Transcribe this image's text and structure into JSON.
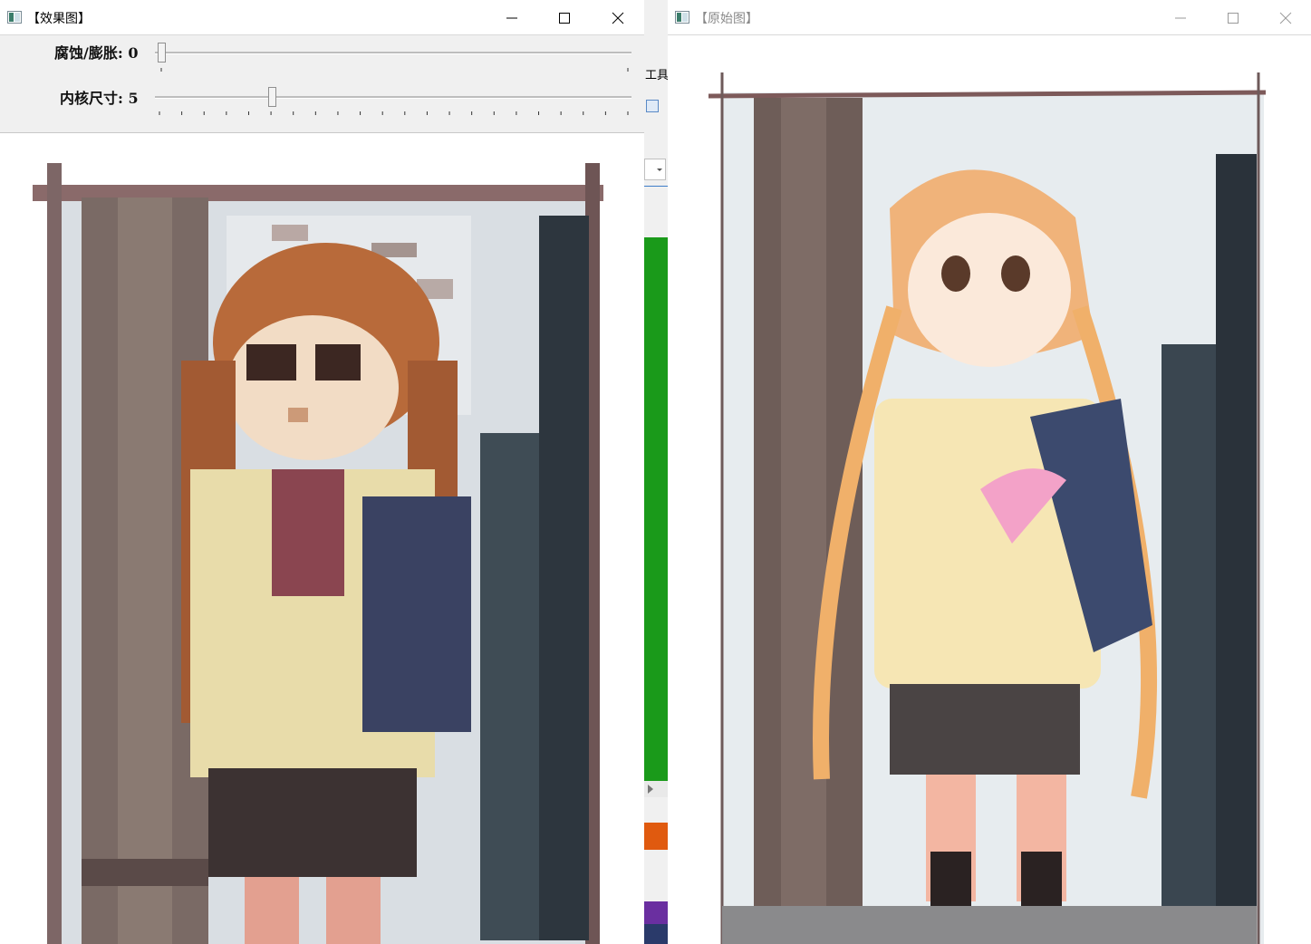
{
  "effect_window": {
    "title": "【效果图】",
    "controls": [
      "minimize",
      "maximize",
      "close"
    ],
    "trackbars": [
      {
        "label": "腐蚀/膨胀: 0",
        "value": 0,
        "max": 1
      },
      {
        "label": "内核尺寸: 5",
        "value": 5,
        "max": 21
      }
    ]
  },
  "original_window": {
    "title": "【原始图】",
    "controls": [
      "minimize",
      "maximize",
      "close"
    ]
  },
  "background_window": {
    "text_fragment": "工具(",
    "accent_colors": [
      "#1a9a1a",
      "#e05a0f",
      "#6a2fa0",
      "#2a3a6a"
    ]
  },
  "icons": {
    "window_icon": "window-app-icon",
    "minimize": "minimize-icon",
    "maximize": "maximize-icon",
    "close": "close-icon"
  }
}
